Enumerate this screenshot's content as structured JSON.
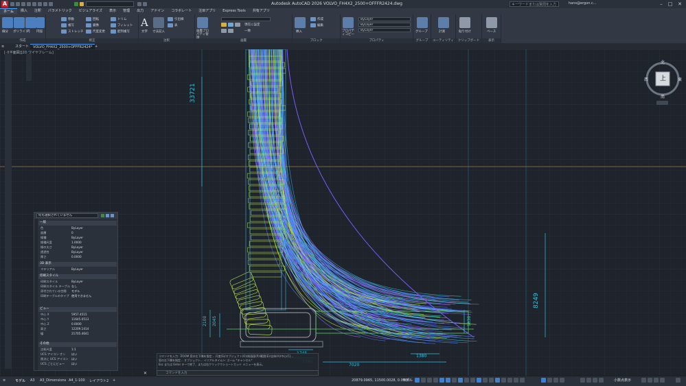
{
  "app": {
    "window_title": "Autodesk AutoCAD 2026   VOLVO_FH4X2_2500+OFFFR2424.dwg",
    "search_placeholder": "キーワードまたは質問を入力",
    "user": "hans@ergon.c...",
    "logo_letter": "A",
    "colors": {
      "accent": "#4aa3ff",
      "logo": "#c8202a",
      "canvas": "#1f242c",
      "dimension": "#2fc4e0"
    }
  },
  "ribbon": {
    "tabs": [
      "ホーム",
      "挿入",
      "注釈",
      "パラメトリック",
      "ビジュアライズ",
      "表示",
      "管理",
      "出力",
      "アドイン",
      "コラボレート",
      "注目アプリ",
      "Express Tools",
      "共有アプリ"
    ],
    "active_tab": "ホーム",
    "panels": [
      "作成",
      "修正",
      "注釈",
      "画層",
      "ブロック",
      "プロパティ",
      "グループ",
      "ユーティリティ",
      "クリップボード",
      "表示"
    ],
    "draw_tools": [
      "線分",
      "ポリライン",
      "円",
      "円弧"
    ],
    "modify_tools": [
      "移動",
      "回転",
      "トリム",
      "複写",
      "鏡像",
      "フィレット",
      "ストレッチ",
      "尺度変更",
      "配列複写"
    ],
    "annotation_tools": [
      "文字",
      "寸法記入",
      "引出線",
      "表"
    ],
    "layer_tools": [
      "画層プロパティ管理",
      "現在に設定",
      "一致"
    ],
    "block_tools": [
      "挿入",
      "作成",
      "編集"
    ],
    "prop_combos": [
      "ByLayer",
      "ByLayer",
      "ByLayer"
    ],
    "prop_label": "プロパティコピー",
    "util_labels": [
      "グループ",
      "計測",
      "貼り付け",
      "ベース"
    ]
  },
  "file_tabs": {
    "start": "スタート",
    "drawing": "VOLVO_FH4X2_2500+OFFFR2424*",
    "add": "+"
  },
  "viewport": {
    "label": "[-][平面図][2D ワイヤフレーム]",
    "viewcube": {
      "top": "上",
      "north": "北",
      "south": "南",
      "east": "東",
      "west": "西"
    }
  },
  "dimensions": {
    "vertical_left": "33721",
    "vertical_right": "8249",
    "d_2100": "2100",
    "d_2045": "2045",
    "d_1830": "1830",
    "d_1745": "1745",
    "d_1740": "1740",
    "d_1380": "1380",
    "d_7020": "7020"
  },
  "properties": {
    "selector": "何も選択されていません",
    "sections": {
      "general": "一般",
      "view3d": "3D 表示",
      "plot": "印刷スタイル",
      "view": "ビュー",
      "misc": "その他"
    },
    "general_rows": [
      {
        "k": "色",
        "v": "ByLayer"
      },
      {
        "k": "画層",
        "v": "0"
      },
      {
        "k": "線種",
        "v": "ByLayer"
      },
      {
        "k": "線種尺度",
        "v": "1.0000"
      },
      {
        "k": "線の太さ",
        "v": "ByLayer"
      },
      {
        "k": "透過性",
        "v": "ByLayer"
      },
      {
        "k": "厚さ",
        "v": "0.0000"
      }
    ],
    "view3d_rows": [
      {
        "k": "マテリアル",
        "v": "ByLayer"
      }
    ],
    "plot_rows": [
      {
        "k": "印刷スタイル",
        "v": "ByLayer"
      },
      {
        "k": "印刷スタイル テーブル",
        "v": "なし"
      },
      {
        "k": "添付されている空間",
        "v": "モデル"
      },
      {
        "k": "印刷テーブルのタイプ",
        "v": "使用できません"
      }
    ],
    "view_rows": [
      {
        "k": "中心 X",
        "v": "5957.4515"
      },
      {
        "k": "中心 Y",
        "v": "11645.0513"
      },
      {
        "k": "中心 Z",
        "v": "0.0000"
      },
      {
        "k": "高さ",
        "v": "12209.1414"
      },
      {
        "k": "幅",
        "v": "21705.4641"
      }
    ],
    "misc_rows": [
      {
        "k": "注釈尺度",
        "v": "1:1"
      },
      {
        "k": "UCS アイコン オン",
        "v": "はい"
      },
      {
        "k": "原点に UCS アイコン",
        "v": "はい"
      },
      {
        "k": "UCS ごとにビュー",
        "v": "はい"
      }
    ]
  },
  "command": {
    "history": [
      "コマンドを入力: 'ZOOM 窓の左下隅を指定... 尺度(S)/オブジェクト(O)/前画面(P)/範囲(E)/全体(A)/中心(C)...",
      "窓の左下隅を指定... オブジェクト... <リアルタイム>: ズーム *キャンセル*",
      "Esc または Enter キーで終了、または右クリックでショートカット メニューを表示。"
    ],
    "prompt": "コマンドを入力"
  },
  "status": {
    "layout_tabs": [
      "モデル",
      "A3",
      "A3_Dimensions",
      "A4_1-100",
      "レイアウト2",
      "+"
    ],
    "coords": "20879.0965, 11500.0028, 0.0000",
    "model": "モデル",
    "scale": "1:1 / 100%",
    "annotation": "小数点表示"
  }
}
